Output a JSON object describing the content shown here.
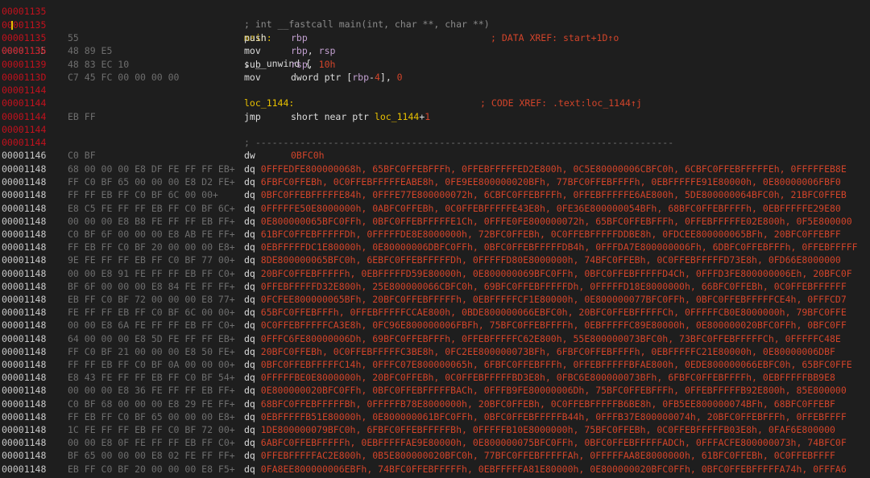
{
  "top": {
    "addrs": [
      "00001135",
      "00001135"
    ],
    "code_fragment": "; int __fastcall main(int, char **, char **)"
  },
  "prologue": [
    {
      "addr": "00001135",
      "bytes": "",
      "label": "main:",
      "xref": "; DATA XREF: start+1D↑o"
    },
    {
      "addr": "00001135",
      "bytes": "",
      "text": "; __unwind {"
    },
    {
      "addr": "00001135",
      "bytes": "55",
      "mn": "push",
      "op": "rbp"
    },
    {
      "addr": "00001136",
      "bytes": "48 89 E5",
      "mn": "mov",
      "op": "rbp, rsp"
    },
    {
      "addr": "00001139",
      "bytes": "48 83 EC 10",
      "mn": "sub",
      "op": "rsp, 10h"
    },
    {
      "addr": "0000113D",
      "bytes": "C7 45 FC 00 00 00 00",
      "mn": "mov",
      "op": "dword ptr [rbp-4], 0"
    },
    {
      "addr": "00001144",
      "bytes": ""
    },
    {
      "addr": "00001144",
      "bytes": "",
      "label": "loc_1144:",
      "xref": "; CODE XREF: .text:loc_1144↑j"
    },
    {
      "addr": "00001144",
      "bytes": "EB FF",
      "mn": "jmp",
      "op": "short near ptr loc_1144+1"
    },
    {
      "addr": "00001144",
      "bytes": ""
    },
    {
      "addr": "00001144",
      "bytes": "",
      "text": "; ---------------------------------------------------------------------------"
    },
    {
      "addr": "00001146",
      "bytes": "C0 BF",
      "mn": "dw",
      "op": "0BFC0h"
    }
  ],
  "data_rows": [
    {
      "addr": "00001148",
      "bytes": "68 00 00 00 E8 DF FE FF FF EB+",
      "vals": "0FFFEDFE800000068h, 65BFC0FFEBFFFh, 0FFEBFFFFFED2E800h, 0C5E80000006CBFC0h, 6CBFC0FFEBFFFFFEh, 0FFFFFEB8E"
    },
    {
      "addr": "00001148",
      "bytes": "FF C0 BF 65 00 00 00 E8 D2 FE+",
      "vals": "6FBFC0FFEBh, 0C0FFEBFFFFFEABE8h, 0FE9EE800000020BFh, 77BFC0FFEBFFFFh, 0EBFFFFFE91E80000h, 0E80000006FBF0"
    },
    {
      "addr": "00001148",
      "bytes": "FF FF EB FF C0 BF 6C 00 00+",
      "vals": "0BFC0FFEBFFFFFE84h, 0FFFE77E800000072h, 6CBFC0FFEBFFFh, 0FFEBFFFFFE6AE800h, 5DE800000064BFC0h, 21BFC0FFEB"
    },
    {
      "addr": "00001148",
      "bytes": "E8 C5 FE FF FF EB FF C0 BF 6C+",
      "vals": "0FFFFFE50E8000000h, 0ABFC0FFEBh, 0C0FFEBFFFFFE43E8h, 0FE36E800000054BFh, 68BFC0FFEBFFFFh, 0EBFFFFFE29E80"
    },
    {
      "addr": "00001148",
      "bytes": "00 00 00 E8 B8 FE FF FF EB FF+",
      "vals": "0E800000065BFC0FFh, 0BFC0FFEBFFFFFE1Ch, 0FFFE0FE800000072h, 65BFC0FFEBFFFh, 0FFEBFFFFFE02E800h, 0F5E800000"
    },
    {
      "addr": "00001148",
      "bytes": "C0 BF 6F 00 00 00 E8 AB FE FF+",
      "vals": "61BFC0FFEBFFFFFDh, 0FFFFFDE8E8000000h, 72BFC0FFEBh, 0C0FFEBFFFFFDDBE8h, 0FDCEE800000065BFh, 20BFC0FFEBFF"
    },
    {
      "addr": "00001148",
      "bytes": "FF EB FF C0 BF 20 00 00 00 E8+",
      "vals": "0EBFFFFFDC1E80000h, 0E80000006DBFC0FFh, 0BFC0FFEBFFFFFDB4h, 0FFFDA7E800000006Fh, 6DBFC0FFEBFFFh, 0FFEBFFFFF"
    },
    {
      "addr": "00001148",
      "bytes": "9E FE FF FF EB FF C0 BF 77 00+",
      "vals": "8DE800000065BFC0h, 6EBFC0FFEBFFFFFDh, 0FFFFFD80E8000000h, 74BFC0FFEBh, 0C0FFEBFFFFFD73E8h, 0FD66E8000000"
    },
    {
      "addr": "00001148",
      "bytes": "00 00 E8 91 FE FF FF EB FF C0+",
      "vals": "20BFC0FFEBFFFFFh, 0EBFFFFFD59E80000h, 0E800000069BFC0FFh, 0BFC0FFEBFFFFFD4Ch, 0FFFD3FE800000006Eh, 20BFC0F"
    },
    {
      "addr": "00001148",
      "bytes": "BF 6F 00 00 00 E8 84 FE FF FF+",
      "vals": "0FFEBFFFFFD32E800h, 25E800000066CBFC0h, 69BFC0FFEBFFFFFDh, 0FFFFFD18E8000000h, 66BFC0FFEBh, 0C0FFEBFFFFFF"
    },
    {
      "addr": "00001148",
      "bytes": "EB FF C0 BF 72 00 00 00 E8 77+",
      "vals": "0FCFEE800000065BFh, 20BFC0FFEBFFFFFh, 0EBFFFFFCF1E80000h, 0E800000077BFC0FFh, 0BFC0FFEBFFFFFCE4h, 0FFFCD7"
    },
    {
      "addr": "00001148",
      "bytes": "FE FF FF EB FF C0 BF 6C 00 00+",
      "vals": "65BFC0FFEBFFFh, 0FFEBFFFFFCCAE800h, 0BDE800000066EBFC0h, 20BFC0FFEBFFFFFCh, 0FFFFFCB0E8000000h, 79BFC0FFE"
    },
    {
      "addr": "00001148",
      "bytes": "00 00 E8 6A FE FF FF EB FF C0+",
      "vals": "0C0FFEBFFFFFCA3E8h, 0FC96E800000006FBFh, 75BFC0FFEBFFFFh, 0EBFFFFFC89E80000h, 0E800000020BFC0FFh, 0BFC0FF"
    },
    {
      "addr": "00001148",
      "bytes": "64 00 00 00 E8 5D FE FF FF EB+",
      "vals": "0FFFC6FE80000006Dh, 69BFC0FFEBFFFh, 0FFEBFFFFFC62E800h, 55E800000073BFC0h, 73BFC0FFEBFFFFFCh, 0FFFFFC48E"
    },
    {
      "addr": "00001148",
      "bytes": "FF C0 BF 21 00 00 00 E8 50 FE+",
      "vals": "20BFC0FFEBh, 0C0FFEBFFFFFC3BE8h, 0FC2EE800000073BFh, 6FBFC0FFEBFFFFh, 0EBFFFFFC21E80000h, 0E80000006DBF"
    },
    {
      "addr": "00001148",
      "bytes": "FF FF EB FF C0 BF 0A 00 00 00+",
      "vals": "0BFC0FFEBFFFFFC14h, 0FFFC07E800000065h, 6FBFC0FFEBFFFh, 0FFEBFFFFFBFAE800h, 0EDE800000066EBFC0h, 65BFC0FFE"
    },
    {
      "addr": "00001148",
      "bytes": "E8 43 FE FF FF EB FF C0 BF 54+",
      "vals": "0FFFFFBE0E8000000h, 20BFC0FFEBh, 0C0FFEBFFFFFBD3E8h, 0FBC6E800000073BFh, 6FBFC0FFEBFFFFh, 0EBFFFFFBB9E8"
    },
    {
      "addr": "00001148",
      "bytes": "00 00 00 E8 36 FE FF FF EB FF+",
      "vals": "0E800000020BFC0FFh, 0BFC0FFEBFFFFFBACh, 0FFFB9FE80000006Dh, 75BFC0FFEBFFFh, 0FFEBFFFFFB92E800h, 85E800000"
    },
    {
      "addr": "00001148",
      "bytes": "C0 BF 68 00 00 00 E8 29 FE FF+",
      "vals": "68BFC0FFEBFFFFFBh, 0FFFFFB78E8000000h, 20BFC0FFEBh, 0C0FFEBFFFFFB6BE8h, 0FB5EE800000074BFh, 68BFC0FFEBF"
    },
    {
      "addr": "00001148",
      "bytes": "FF EB FF C0 BF 65 00 00 00 E8+",
      "vals": "0EBFFFFFB51E80000h, 0E800000061BFC0FFh, 0BFC0FFEBFFFFFB44h, 0FFFB37E800000074h, 20BFC0FFEBFFFh, 0FFEBFFFF"
    },
    {
      "addr": "00001148",
      "bytes": "1C FE FF FF EB FF C0 BF 72 00+",
      "vals": "1DE800000079BFC0h, 6FBFC0FFEBFFFFFBh, 0FFFFFB10E8000000h, 75BFC0FFEBh, 0C0FFEBFFFFFB03E8h, 0FAF6E800000"
    },
    {
      "addr": "00001148",
      "bytes": "00 00 E8 0F FE FF FF EB FF C0+",
      "vals": "6ABFC0FFEBFFFFFh, 0EBFFFFFAE9E80000h, 0E800000075BFC0FFh, 0BFC0FFEBFFFFFADCh, 0FFFACFE800000073h, 74BFC0F"
    },
    {
      "addr": "00001148",
      "bytes": "BF 65 00 00 00 E8 02 FE FF FF+",
      "vals": "0FFEBFFFFFAC2E800h, 0B5E800000020BFC0h, 77BFC0FFEBFFFFFAh, 0FFFFFAA8E8000000h, 61BFC0FFEBh, 0C0FFEBFFFF"
    },
    {
      "addr": "00001148",
      "bytes": "EB FF C0 BF 20 00 00 00 E8 F5+",
      "vals": "0FA8EE800000006EBFh, 74BFC0FFEBFFFFFh, 0EBFFFFFA81E80000h, 0E800000020BFC0FFh, 0BFC0FFEBFFFFFA74h, 0FFFA6"
    }
  ]
}
